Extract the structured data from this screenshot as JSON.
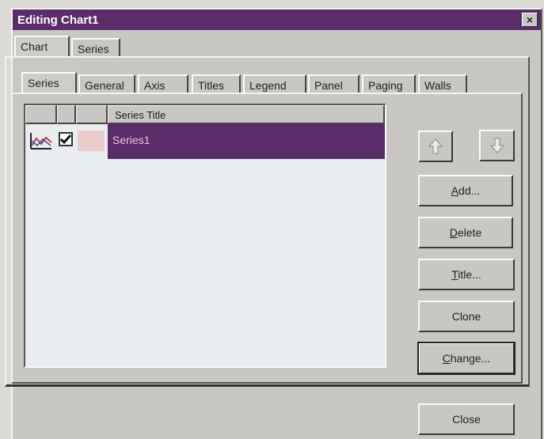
{
  "window": {
    "title": "Editing Chart1",
    "close_glyph": "×"
  },
  "top_tabs": [
    {
      "label": "Chart"
    },
    {
      "label": "Series"
    }
  ],
  "sub_tabs": [
    {
      "label": "Series"
    },
    {
      "label": "General"
    },
    {
      "label": "Axis"
    },
    {
      "label": "Titles"
    },
    {
      "label": "Legend"
    },
    {
      "label": "Panel"
    },
    {
      "label": "Paging"
    },
    {
      "label": "Walls"
    }
  ],
  "series_list": {
    "column_title": "Series Title",
    "rows": [
      {
        "title": "Series1",
        "visible": true,
        "icon": "line-chart-icon"
      }
    ]
  },
  "buttons": {
    "move_up_icon": "up-arrow-icon",
    "move_down_icon": "down-arrow-icon",
    "add": "Add...",
    "delete": "Delete",
    "title": "Title...",
    "clone": "Clone",
    "change": "Change...",
    "close": "Close"
  },
  "colors": {
    "titlebar": "#5a2c6a",
    "selection": "#5a2c6a",
    "face": "#c9c7c3"
  }
}
